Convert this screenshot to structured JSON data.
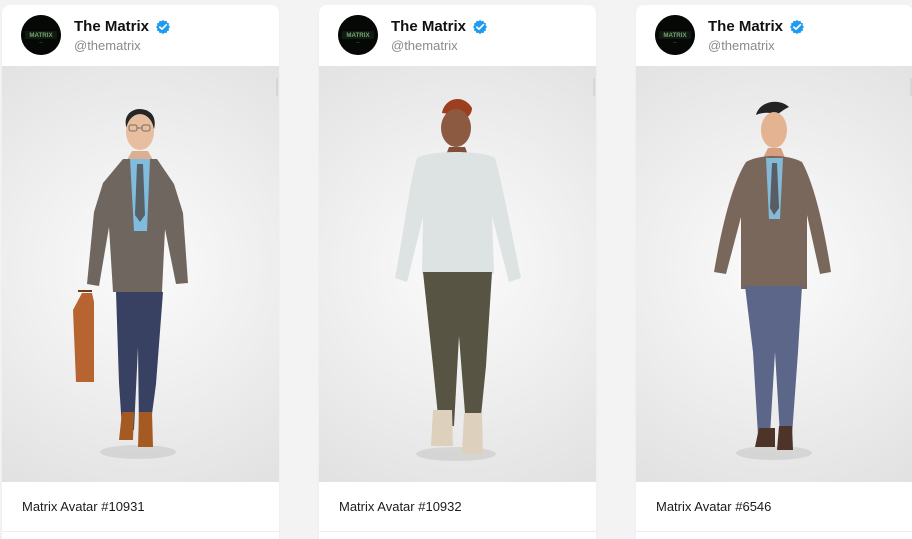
{
  "colors": {
    "page_background": "#f3f3f4",
    "card_background": "#ffffff",
    "verified_blue": "#1d9bf0",
    "text_primary": "#111111",
    "text_secondary": "#8a8a8a"
  },
  "cards": [
    {
      "account": {
        "name": "The Matrix",
        "handle": "@thematrix",
        "avatar_label": "MATRIX",
        "verified_icon": "verified-check-icon"
      },
      "media": {
        "kind": "3d-avatar",
        "subject": "man in tweed blazer with briefcase"
      },
      "caption": "Matrix Avatar #10931"
    },
    {
      "account": {
        "name": "The Matrix",
        "handle": "@thematrix",
        "avatar_label": "MATRIX",
        "verified_icon": "verified-check-icon"
      },
      "media": {
        "kind": "3d-avatar",
        "subject": "man in white sweater and olive trousers"
      },
      "caption": "Matrix Avatar #10932"
    },
    {
      "account": {
        "name": "The Matrix",
        "handle": "@thematrix",
        "avatar_label": "MATRIX",
        "verified_icon": "verified-check-icon"
      },
      "media": {
        "kind": "3d-avatar",
        "subject": "woman in brown blazer and blue trousers"
      },
      "caption": "Matrix Avatar #6546"
    }
  ]
}
